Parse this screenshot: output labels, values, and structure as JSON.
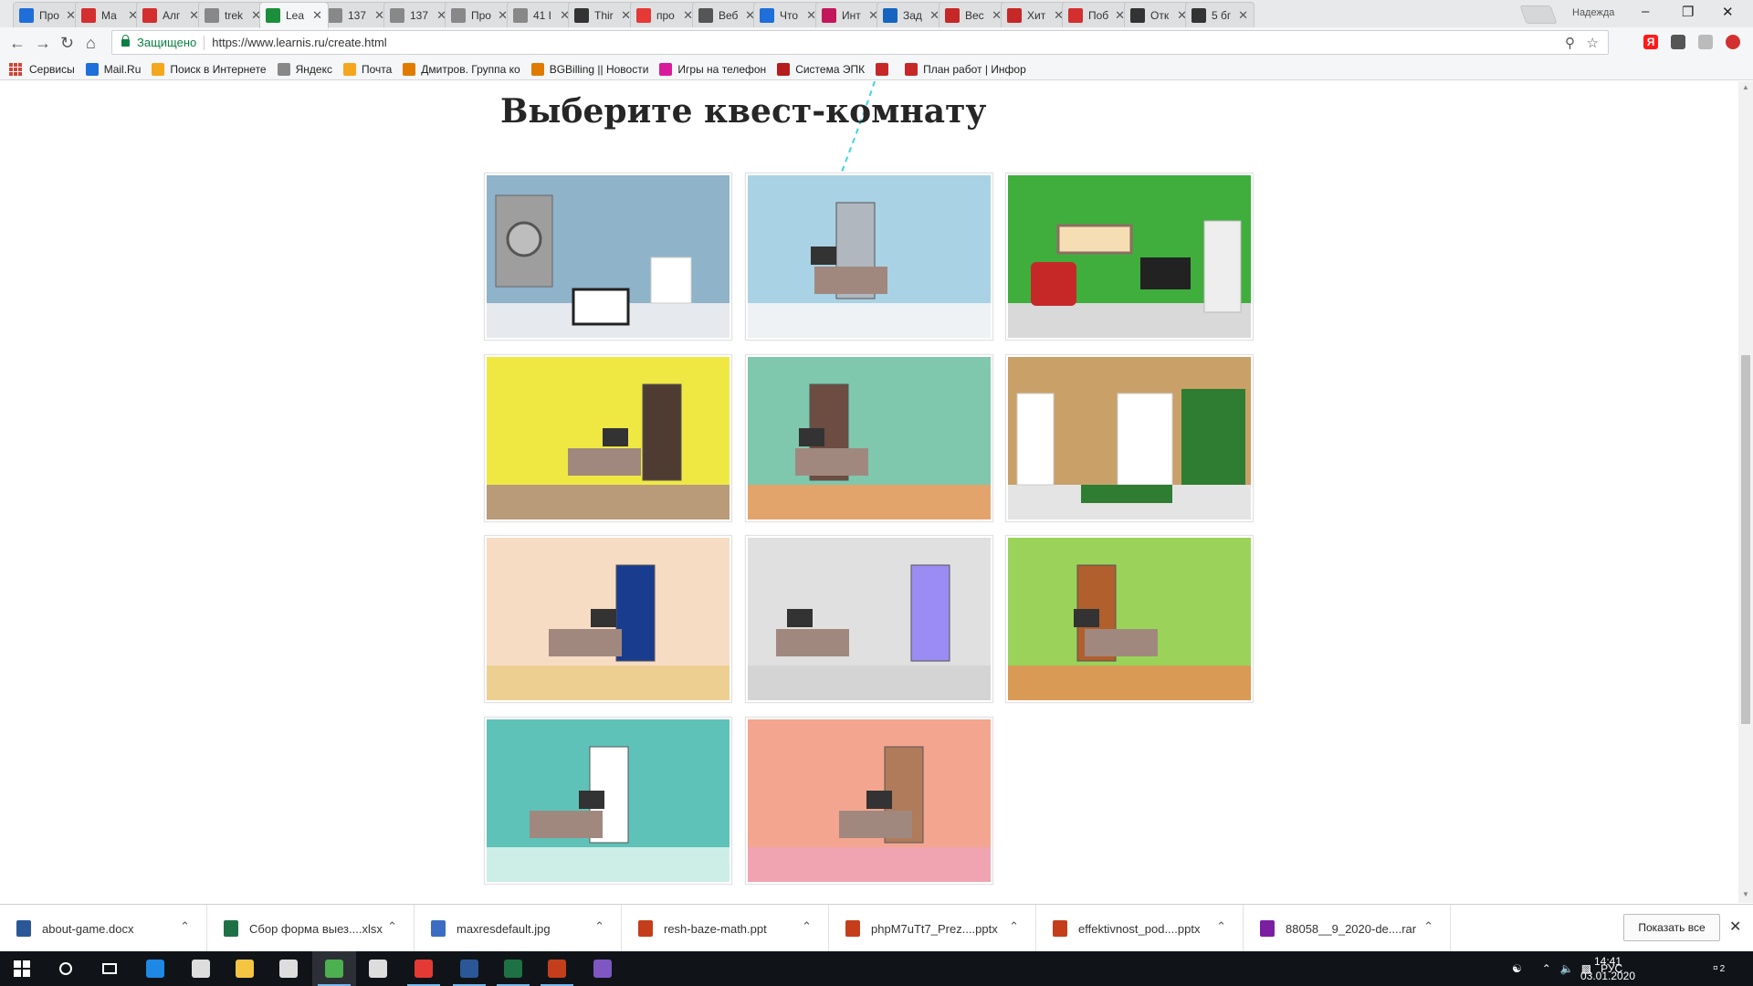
{
  "browser": {
    "tabs": [
      {
        "label": "Про",
        "color": "#1e6fd9",
        "icon": "check-icon"
      },
      {
        "label": "Ма",
        "color": "#d32f2f",
        "icon": "pdf-icon"
      },
      {
        "label": "Алг",
        "color": "#d32f2f",
        "icon": "pdf-icon"
      },
      {
        "label": "trek",
        "color": "#888888",
        "icon": "document-icon"
      },
      {
        "label": "Lea",
        "color": "#1b8f3a",
        "icon": "learnis-icon"
      },
      {
        "label": "137",
        "color": "#888888",
        "icon": "document-icon"
      },
      {
        "label": "137",
        "color": "#888888",
        "icon": "document-icon"
      },
      {
        "label": "Про",
        "color": "#888888",
        "icon": "document-icon"
      },
      {
        "label": "41 I",
        "color": "#888888",
        "icon": "document-icon"
      },
      {
        "label": "Thir",
        "color": "#333333",
        "icon": "dots-icon"
      },
      {
        "label": "про",
        "color": "#e53935",
        "icon": "yandex-icon"
      },
      {
        "label": "Веб",
        "color": "#555555",
        "icon": "monitor-icon"
      },
      {
        "label": "Что",
        "color": "#1e6fd9",
        "icon": "square-icon"
      },
      {
        "label": "Инт",
        "color": "#c2185b",
        "icon": "m-icon"
      },
      {
        "label": "Зад",
        "color": "#1565c0",
        "icon": "pen-icon"
      },
      {
        "label": "Вес",
        "color": "#c62828",
        "icon": "lips-icon"
      },
      {
        "label": "Хит",
        "color": "#c62828",
        "icon": "lips-icon"
      },
      {
        "label": "Поб",
        "color": "#d32f2f",
        "icon": "ng-icon"
      },
      {
        "label": "Отк",
        "color": "#333333",
        "icon": "plus-icon"
      },
      {
        "label": "5 бг",
        "color": "#333333",
        "icon": "plus-icon"
      }
    ],
    "active_tab_index": 4,
    "profile_name": "Надежда",
    "secure_label": "Защищено",
    "url": "https://www.learnis.ru/create.html"
  },
  "bookmarks": [
    {
      "label": "Сервисы",
      "color": "#d04437",
      "icon": "apps-icon"
    },
    {
      "label": "Mail.Ru",
      "color": "#1e6fd9",
      "icon": "mailru-icon"
    },
    {
      "label": "Поиск в Интернете",
      "color": "#f4a61d",
      "icon": "search-globe-icon"
    },
    {
      "label": "Яндекс",
      "color": "#888888",
      "icon": "document-icon"
    },
    {
      "label": "Почта",
      "color": "#f4a61d",
      "icon": "envelope-icon"
    },
    {
      "label": "Дмитров. Группа ко",
      "color": "#e07b00",
      "icon": "leaf-icon"
    },
    {
      "label": "BGBilling || Новости",
      "color": "#e07b00",
      "icon": "leaf-icon"
    },
    {
      "label": "Игры на телефон",
      "color": "#d81b9b",
      "icon": "game-icon"
    },
    {
      "label": "Система ЭПК",
      "color": "#b71c1c",
      "icon": "hat-icon"
    },
    {
      "label": "",
      "color": "#c62828",
      "icon": "bookmark-icon"
    },
    {
      "label": "План работ | Инфор",
      "color": "#c62828",
      "icon": "plan-icon"
    }
  ],
  "page": {
    "title": "Выберите квест-комнату",
    "rooms": [
      {
        "wall": "#8fb3c9",
        "floor": "#e6e9ee",
        "accent": "#9e9e9e",
        "feature": "safe"
      },
      {
        "wall": "#a9d2e4",
        "floor": "#eef2f5",
        "accent": "#b0b7be",
        "feature": "door"
      },
      {
        "wall": "#3fae3c",
        "floor": "#d9d9d9",
        "accent": "#c62828",
        "feature": "sofa"
      },
      {
        "wall": "#efe843",
        "floor": "#b99a79",
        "accent": "#4e3c33",
        "feature": "door"
      },
      {
        "wall": "#7fc8ad",
        "floor": "#e2a46b",
        "accent": "#6d4c41",
        "feature": "door"
      },
      {
        "wall": "#c9a067",
        "floor": "#e4e4e4",
        "accent": "#2e7d32",
        "feature": "curtain"
      },
      {
        "wall": "#f6dcc3",
        "floor": "#eecf92",
        "accent": "#1a3c8f",
        "feature": "door"
      },
      {
        "wall": "#e0e0e0",
        "floor": "#d4d4d4",
        "accent": "#9a8cf2",
        "feature": "door"
      },
      {
        "wall": "#9bd35a",
        "floor": "#d99a55",
        "accent": "#b05f2d",
        "feature": "door"
      },
      {
        "wall": "#5fc2b8",
        "floor": "#cdeee7",
        "accent": "#ffffff",
        "feature": "door"
      },
      {
        "wall": "#f4a58f",
        "floor": "#f0a4b1",
        "accent": "#b07b5a",
        "feature": "door"
      }
    ]
  },
  "downloads": [
    {
      "name": "about-game.docx",
      "color": "#2b5797"
    },
    {
      "name": "Сбор форма выез....xlsx",
      "color": "#1e7145"
    },
    {
      "name": "maxresdefault.jpg",
      "color": "#3b6ec2"
    },
    {
      "name": "resh-baze-math.ppt",
      "color": "#c43e1c"
    },
    {
      "name": "phpM7uTt7_Prez....pptx",
      "color": "#c43e1c"
    },
    {
      "name": "effektivnost_pod....pptx",
      "color": "#c43e1c"
    },
    {
      "name": "88058__9_2020-de....rar",
      "color": "#7b1fa2"
    }
  ],
  "downloads_show_all": "Показать все",
  "taskbar": {
    "apps": [
      {
        "name": "start",
        "color": "#ffffff"
      },
      {
        "name": "search",
        "color": "#ffffff"
      },
      {
        "name": "task-view",
        "color": "#ffffff"
      },
      {
        "name": "edge",
        "color": "#1e88e5"
      },
      {
        "name": "calculator",
        "color": "#dddddd"
      },
      {
        "name": "explorer",
        "color": "#f4c542"
      },
      {
        "name": "store",
        "color": "#dddddd"
      },
      {
        "name": "chrome",
        "color": "#4caf50"
      },
      {
        "name": "mail",
        "color": "#dddddd"
      },
      {
        "name": "opera",
        "color": "#e53935"
      },
      {
        "name": "word",
        "color": "#2b5797"
      },
      {
        "name": "excel",
        "color": "#1e7145"
      },
      {
        "name": "powerpoint",
        "color": "#c43e1c"
      },
      {
        "name": "app-extra",
        "color": "#7e57c2"
      }
    ],
    "lang": "РУС",
    "time": "14:41",
    "date": "03.01.2020",
    "notifications": "2"
  }
}
